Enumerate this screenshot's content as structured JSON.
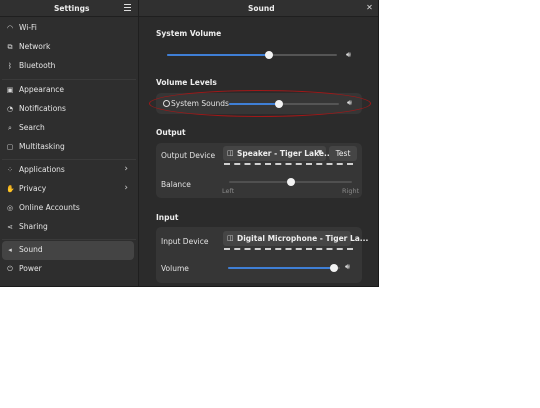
{
  "header": {
    "settings_title": "Settings",
    "panel_title": "Sound"
  },
  "sidebar": {
    "items": [
      {
        "label": "Wi-Fi",
        "icon": "wifi-icon"
      },
      {
        "label": "Network",
        "icon": "network-icon"
      },
      {
        "label": "Bluetooth",
        "icon": "bluetooth-icon"
      },
      {
        "label": "Appearance",
        "icon": "appearance-icon"
      },
      {
        "label": "Notifications",
        "icon": "bell-icon"
      },
      {
        "label": "Search",
        "icon": "search-icon"
      },
      {
        "label": "Multitasking",
        "icon": "multitasking-icon"
      },
      {
        "label": "Applications",
        "icon": "apps-icon"
      },
      {
        "label": "Privacy",
        "icon": "privacy-icon"
      },
      {
        "label": "Online Accounts",
        "icon": "accounts-icon"
      },
      {
        "label": "Sharing",
        "icon": "sharing-icon"
      },
      {
        "label": "Sound",
        "icon": "speaker-icon"
      },
      {
        "label": "Power",
        "icon": "power-icon"
      }
    ],
    "active": "Sound"
  },
  "system_volume": {
    "title": "System Volume",
    "level": 0.6
  },
  "volume_levels": {
    "title": "Volume Levels",
    "system_sounds_label": "System Sounds",
    "level": 0.45
  },
  "output": {
    "title": "Output",
    "device_label": "Output Device",
    "device_value": "Speaker - Tiger Lake...",
    "test_label": "Test",
    "balance_label": "Balance",
    "balance_left": "Left",
    "balance_right": "Right",
    "balance": 0.5
  },
  "input": {
    "title": "Input",
    "device_label": "Input Device",
    "device_value": "Digital Microphone - Tiger La...",
    "volume_label": "Volume",
    "volume_level": 0.95
  },
  "colors": {
    "accent": "#3f7fd6",
    "annotation": "#a01818"
  }
}
